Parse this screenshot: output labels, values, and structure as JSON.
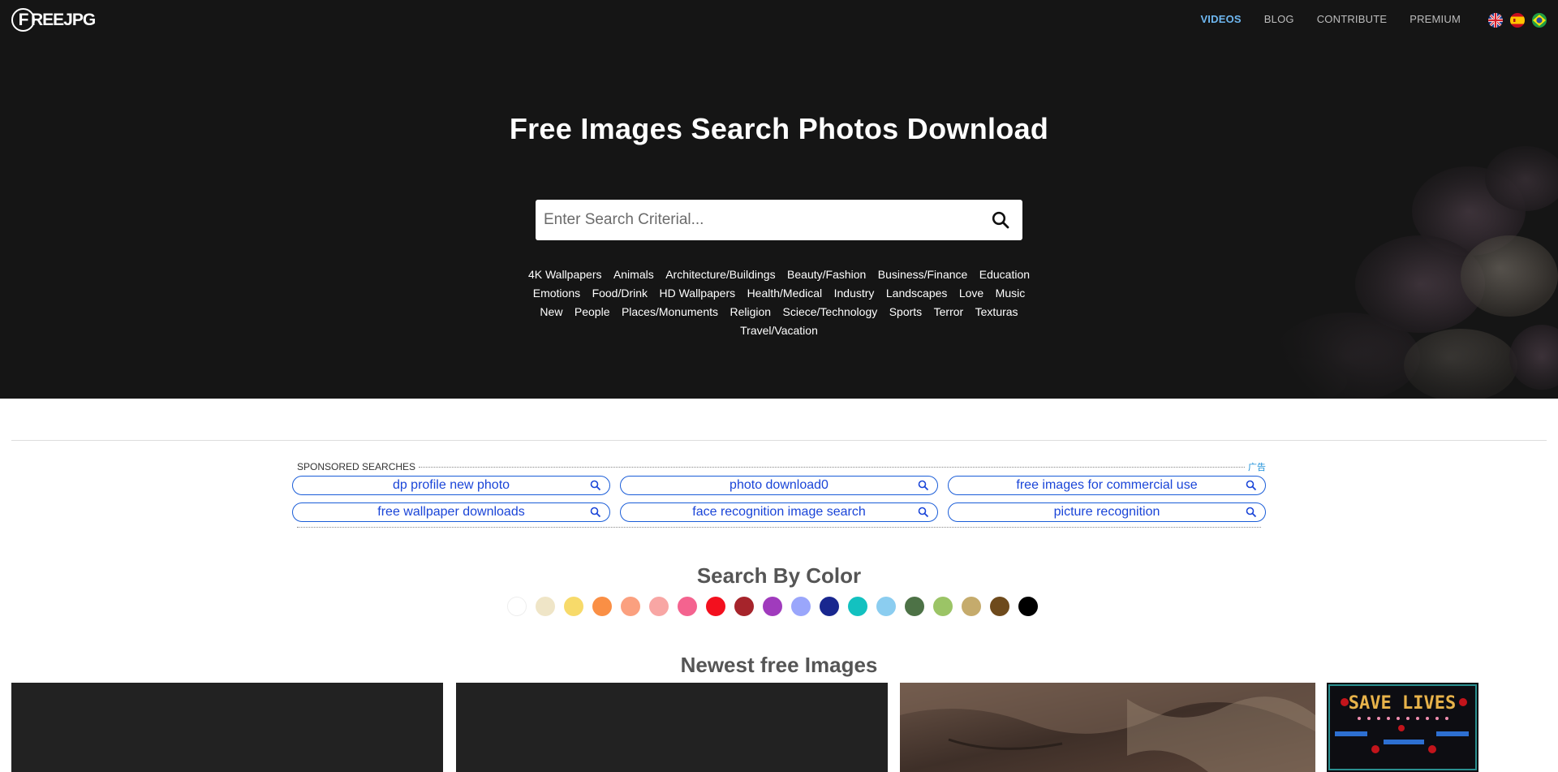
{
  "logo": {
    "letter": "F",
    "text": "REEJPG"
  },
  "nav": [
    {
      "label": "VIDEOS",
      "active": true
    },
    {
      "label": "BLOG",
      "active": false
    },
    {
      "label": "CONTRIBUTE",
      "active": false
    },
    {
      "label": "PREMIUM",
      "active": false
    }
  ],
  "flags": [
    "uk-flag-icon",
    "spain-flag-icon",
    "brazil-flag-icon"
  ],
  "hero": {
    "title": "Free Images Search Photos Download",
    "search_placeholder": "Enter Search Criterial..."
  },
  "categories": [
    "4K Wallpapers",
    "Animals",
    "Architecture/Buildings",
    "Beauty/Fashion",
    "Business/Finance",
    "Education",
    "Emotions",
    "Food/Drink",
    "HD Wallpapers",
    "Health/Medical",
    "Industry",
    "Landscapes",
    "Love",
    "Music",
    "New",
    "People",
    "Places/Monuments",
    "Religion",
    "Sciece/Technology",
    "Sports",
    "Terror",
    "Texturas",
    "Travel/Vacation"
  ],
  "sponsored": {
    "heading": "SPONSORED SEARCHES",
    "ad_label": "广告",
    "items": [
      "dp profile new photo",
      "photo download0",
      "free images for commercial use",
      "free wallpaper downloads",
      "face recognition image search",
      "picture recognition"
    ]
  },
  "colors": {
    "title": "Search By Color",
    "swatches": [
      "#ffffff",
      "#efe5c7",
      "#f7da6a",
      "#fa8f45",
      "#fba07f",
      "#f8a6a4",
      "#f4638f",
      "#f3101e",
      "#a6242b",
      "#a03bbd",
      "#9aa6fb",
      "#19278f",
      "#13c1c0",
      "#8bcdf0",
      "#4d7246",
      "#9bc466",
      "#c5ab6c",
      "#6e4a1c",
      "#000000"
    ]
  },
  "newest": {
    "title": "Newest free Images",
    "thumb_text": "SAVE LIVES"
  }
}
